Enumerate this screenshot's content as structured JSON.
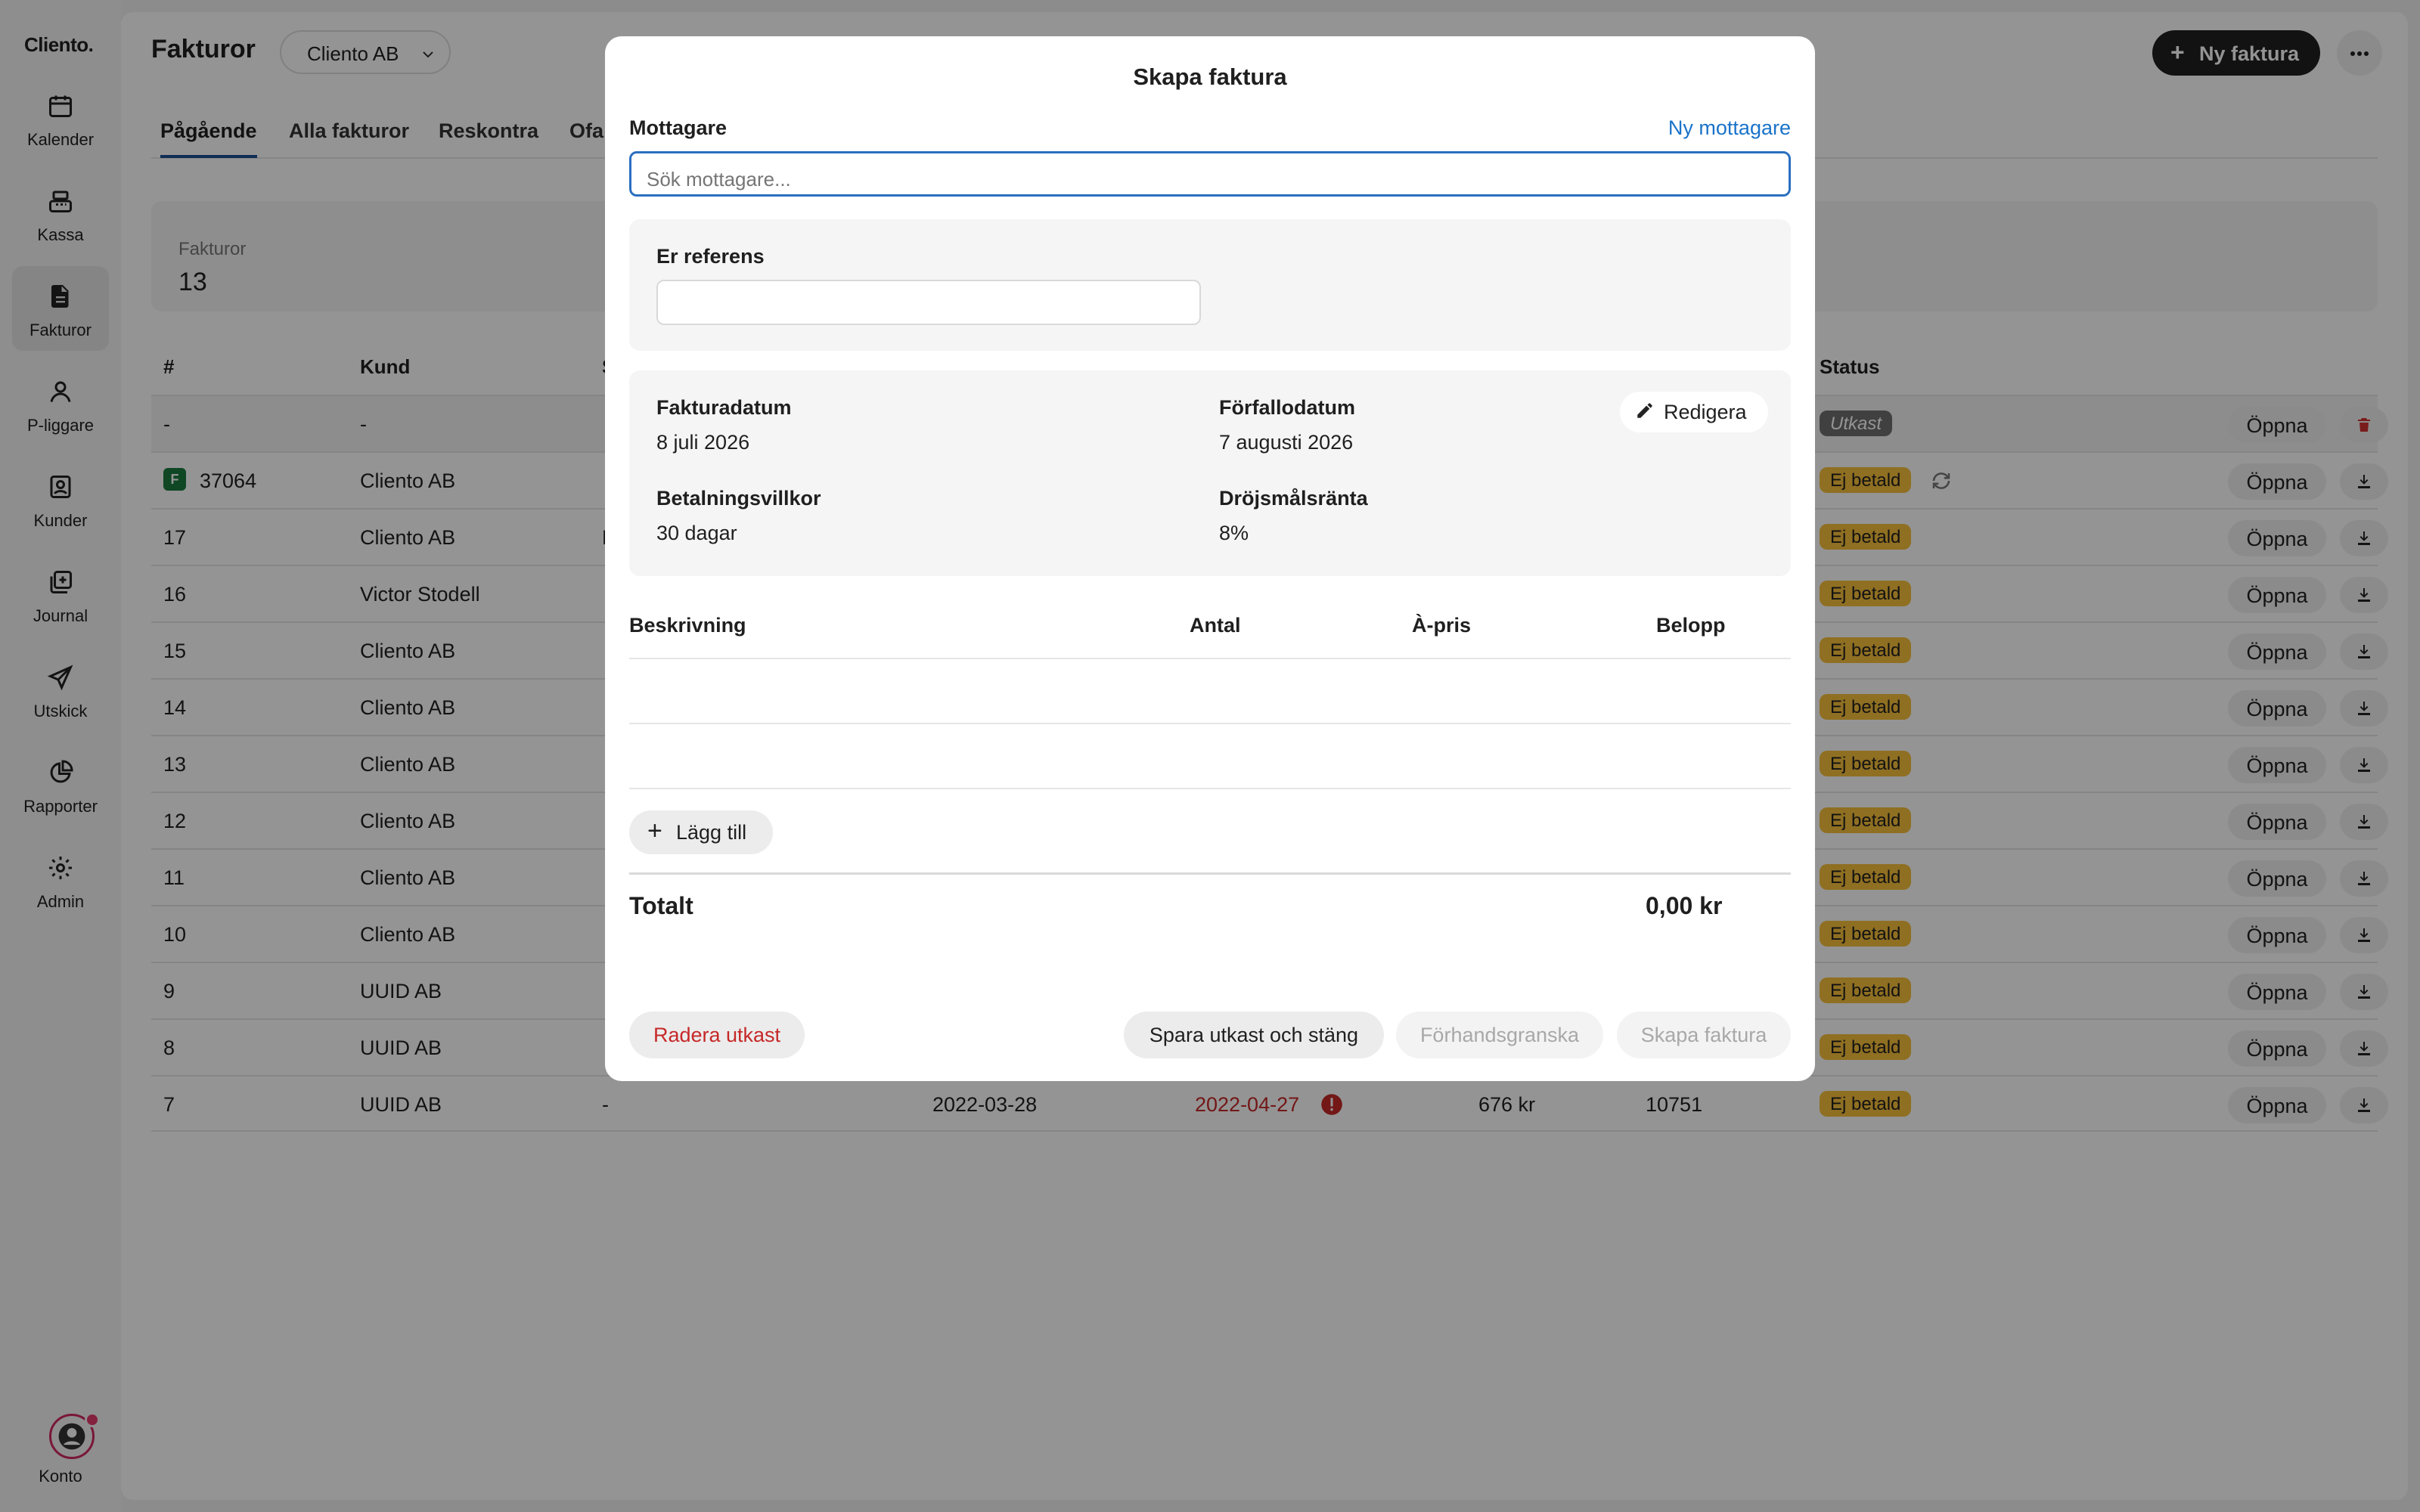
{
  "app": {
    "logo": "Cliento.",
    "nav": [
      {
        "label": "Kalender",
        "icon": "calendar-icon",
        "active": false
      },
      {
        "label": "Kassa",
        "icon": "cash-register-icon",
        "active": false
      },
      {
        "label": "Fakturor",
        "icon": "document-icon",
        "active": true
      },
      {
        "label": "P-liggare",
        "icon": "person-icon",
        "active": false
      },
      {
        "label": "Kunder",
        "icon": "contact-card-icon",
        "active": false
      },
      {
        "label": "Journal",
        "icon": "journal-icon",
        "active": false
      },
      {
        "label": "Utskick",
        "icon": "send-icon",
        "active": false
      },
      {
        "label": "Rapporter",
        "icon": "pie-chart-icon",
        "active": false
      },
      {
        "label": "Admin",
        "icon": "gear-icon",
        "active": false
      }
    ],
    "account_label": "Konto"
  },
  "header": {
    "title": "Fakturor",
    "company": "Cliento AB",
    "new_invoice_label": "Ny faktura",
    "tabs": [
      "Pågående",
      "Alla fakturor",
      "Reskontra",
      "Ofa"
    ]
  },
  "stats": {
    "label": "Fakturor",
    "value": "13"
  },
  "table": {
    "columns": [
      "#",
      "Kund",
      "S",
      "Status"
    ],
    "open_label": "Öppna",
    "rows": [
      {
        "num": "-",
        "kund": "-",
        "extra": "-",
        "status": "Utkast",
        "draft": true
      },
      {
        "num": "37064",
        "kund": "Cliento AB",
        "extra": "-",
        "status": "Ej betald",
        "fortnox": true
      },
      {
        "num": "17",
        "kund": "Cliento AB",
        "extra": "F",
        "status": "Ej betald"
      },
      {
        "num": "16",
        "kund": "Victor Stodell",
        "extra": "-",
        "status": "Ej betald"
      },
      {
        "num": "15",
        "kund": "Cliento AB",
        "extra": "-",
        "status": "Ej betald"
      },
      {
        "num": "14",
        "kund": "Cliento AB",
        "extra": "-",
        "status": "Ej betald"
      },
      {
        "num": "13",
        "kund": "Cliento AB",
        "extra": "-",
        "status": "Ej betald"
      },
      {
        "num": "12",
        "kund": "Cliento AB",
        "extra": "-",
        "status": "Ej betald"
      },
      {
        "num": "11",
        "kund": "Cliento AB",
        "extra": "-",
        "status": "Ej betald"
      },
      {
        "num": "10",
        "kund": "Cliento AB",
        "extra": "-",
        "status": "Ej betald"
      },
      {
        "num": "9",
        "kund": "UUID AB",
        "extra": "-",
        "status": "Ej betald"
      },
      {
        "num": "8",
        "kund": "UUID AB",
        "extra": "-",
        "status": "Ej betald"
      },
      {
        "num": "7",
        "kund": "UUID AB",
        "extra": "-",
        "status": "Ej betald",
        "date": "2022-03-28",
        "due": "2022-04-27",
        "amount": "676 kr",
        "ocr": "10751"
      }
    ]
  },
  "modal": {
    "title": "Skapa faktura",
    "recipient_label": "Mottagare",
    "new_recipient_link": "Ny mottagare",
    "search_placeholder": "Sök mottagare...",
    "reference_label": "Er referens",
    "invoice_date_label": "Fakturadatum",
    "invoice_date": "8 juli 2026",
    "due_date_label": "Förfallodatum",
    "due_date": "7 augusti 2026",
    "edit_label": "Redigera",
    "terms_label": "Betalningsvillkor",
    "terms": "30 dagar",
    "interest_label": "Dröjsmålsränta",
    "interest": "8%",
    "columns": [
      "Beskrivning",
      "Antal",
      "À-pris",
      "Belopp"
    ],
    "add_label": "Lägg till",
    "total_label": "Totalt",
    "total_value": "0,00 kr",
    "delete_draft_label": "Radera utkast",
    "save_draft_label": "Spara utkast och stäng",
    "preview_label": "Förhandsgranska",
    "create_label": "Skapa faktura"
  }
}
